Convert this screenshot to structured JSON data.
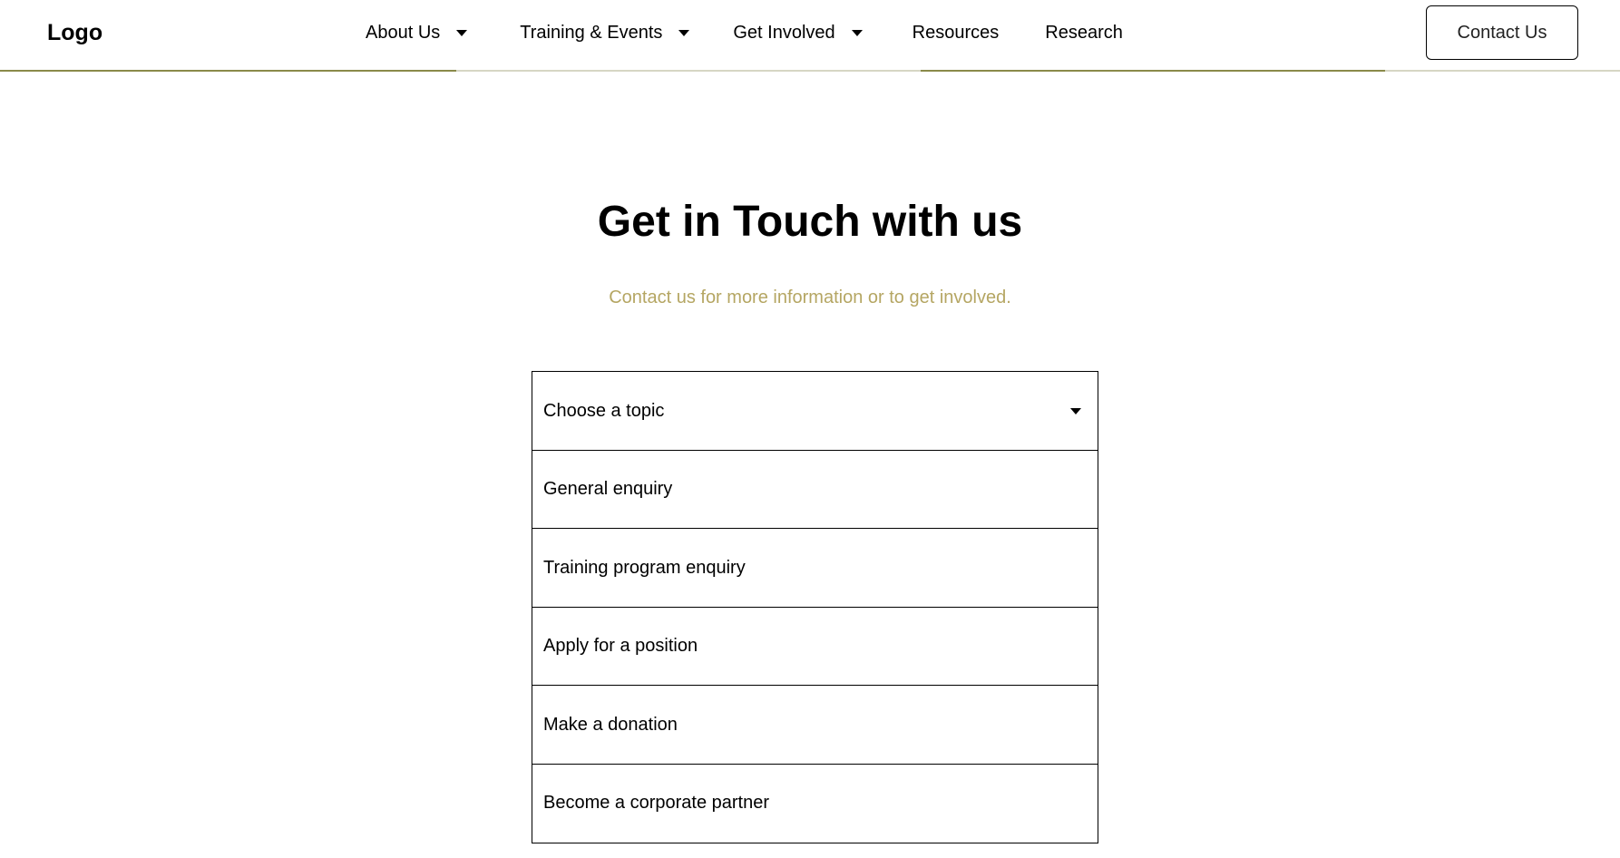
{
  "header": {
    "logo": "Logo",
    "nav": {
      "about": "About Us",
      "training": "Training & Events",
      "involved": "Get Involved",
      "resources": "Resources",
      "research": "Research"
    },
    "contact_button": "Contact Us"
  },
  "main": {
    "title": "Get in Touch with us",
    "subtitle": "Contact us for more information or to get involved.",
    "topic_select": {
      "placeholder": "Choose a topic",
      "options": [
        "General enquiry",
        "Training program enquiry",
        "Apply for a position",
        "Make a donation",
        "Become a corporate partner"
      ]
    }
  },
  "colors": {
    "accent": "#b5a663",
    "rule_accent": "#8a8a4a",
    "rule_light": "#d6d6c4",
    "text": "#000000",
    "background": "#ffffff"
  },
  "icons": {
    "dropdown": "chevron-down-icon"
  }
}
